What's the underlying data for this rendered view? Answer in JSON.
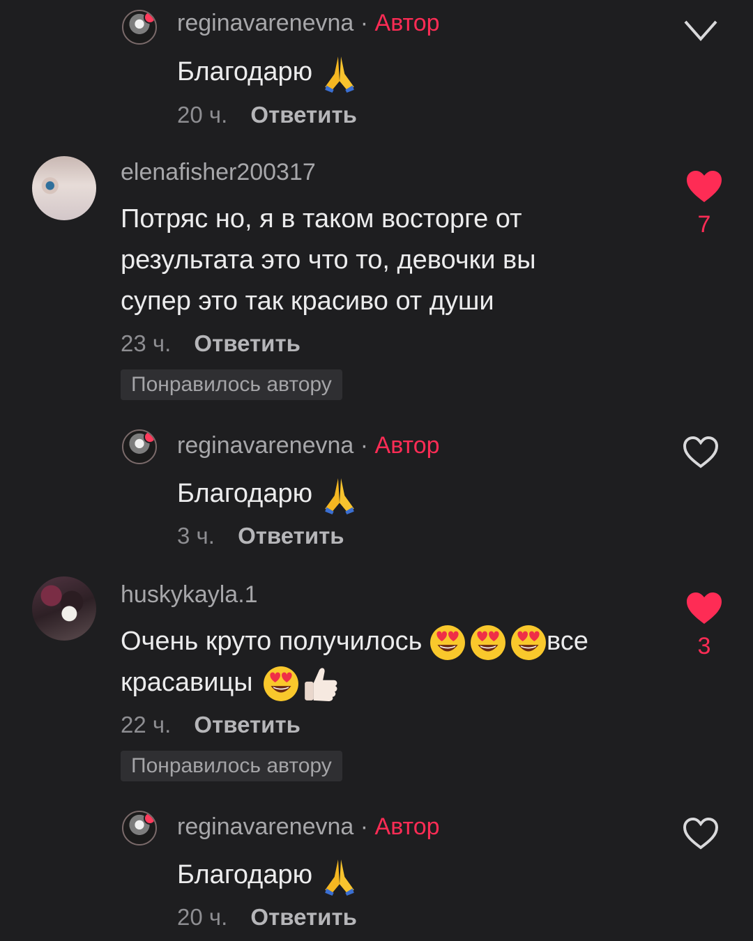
{
  "comments": [
    {
      "username": "reginavarenevna",
      "author_tag": "Автор",
      "text": "Благодарю",
      "emojis": [
        "folded-hands"
      ],
      "time": "20 ч.",
      "reply_label": "Ответить",
      "liked": false,
      "is_reply": true
    },
    {
      "username": "elenafisher200317",
      "lines": [
        "Потряс но, я в таком восторге от",
        "результата это что то, девочки вы",
        "супер это так красиво от души"
      ],
      "time": "23 ч.",
      "reply_label": "Ответить",
      "badge": "Понравилось автору",
      "liked": true,
      "like_count": "7"
    },
    {
      "username": "reginavarenevna",
      "author_tag": "Автор",
      "text": "Благодарю",
      "emojis": [
        "folded-hands"
      ],
      "time": "3 ч.",
      "reply_label": "Ответить",
      "liked": false,
      "is_reply": true
    },
    {
      "username": "huskykayla.1",
      "line1_text": "Очень круто получилось",
      "line1_suffix": "все",
      "line2_text": "красавицы",
      "emojis": [
        "heart-eyes",
        "heart-eyes",
        "heart-eyes",
        "heart-eyes",
        "thumbs-up-light"
      ],
      "time": "22 ч.",
      "reply_label": "Ответить",
      "badge": "Понравилось автору",
      "liked": true,
      "like_count": "3"
    },
    {
      "username": "reginavarenevna",
      "author_tag": "Автор",
      "text": "Благодарю",
      "emojis": [
        "folded-hands"
      ],
      "time": "20 ч.",
      "reply_label": "Ответить",
      "liked": false,
      "is_reply": true
    }
  ],
  "separator": "·",
  "colors": {
    "background": "#1e1e20",
    "accent": "#fe2c55",
    "username": "#a7a7aa",
    "badge_bg": "#2f2f32"
  }
}
